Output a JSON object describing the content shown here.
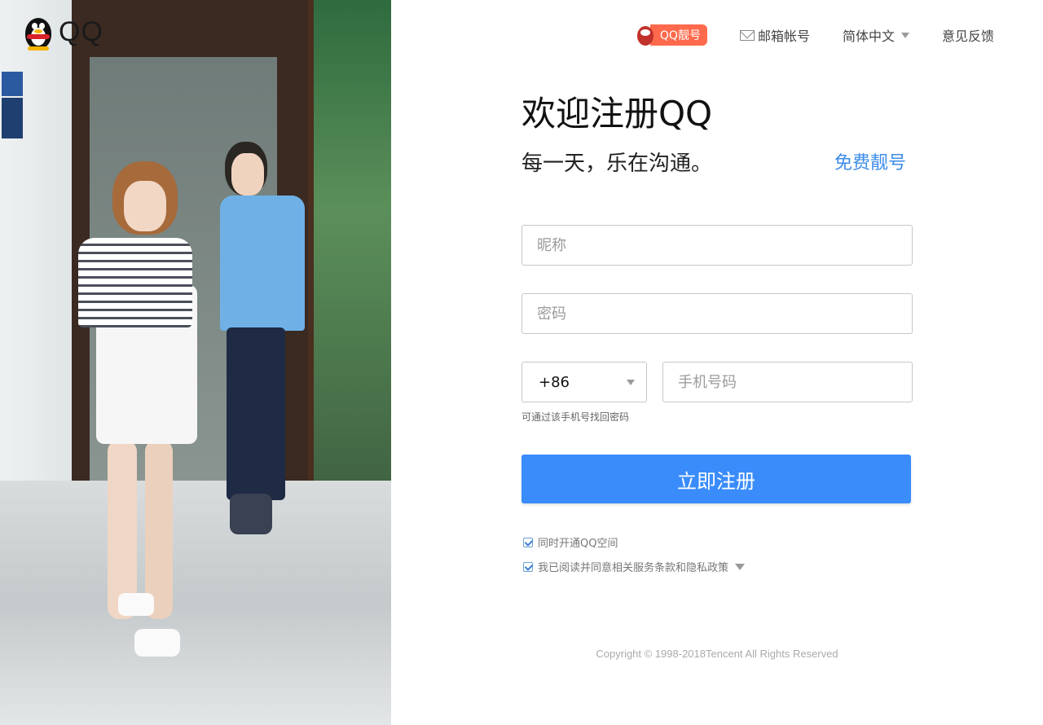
{
  "brand": {
    "name": "QQ"
  },
  "topnav": {
    "pretty_number": "QQ靓号",
    "mail_account": "邮箱帐号",
    "language": "简体中文",
    "feedback": "意见反馈"
  },
  "main": {
    "title": "欢迎注册QQ",
    "subtitle": "每一天，乐在沟通。",
    "free_pretty_link": "免费靓号"
  },
  "form": {
    "nickname_placeholder": "昵称",
    "password_placeholder": "密码",
    "country_code": "+86",
    "phone_placeholder": "手机号码",
    "phone_hint": "可通过该手机号找回密码",
    "submit_label": "立即注册",
    "checkbox_qzone": {
      "label": "同时开通QQ空间",
      "checked": true
    },
    "checkbox_terms": {
      "label": "我已阅读并同意相关服务条款和隐私政策",
      "checked": true
    }
  },
  "footer": {
    "copyright": "Copyright © 1998-2018Tencent All Rights Reserved"
  },
  "colors": {
    "accent_blue": "#3a8cfb",
    "link_blue": "#3c8ce7",
    "badge_orange": "#ff6a4d"
  },
  "icons": [
    "qq-penguin-logo-icon",
    "pretty-number-penguin-icon",
    "mail-envelope-icon",
    "chevron-down-icon",
    "checkbox-checked-icon"
  ]
}
